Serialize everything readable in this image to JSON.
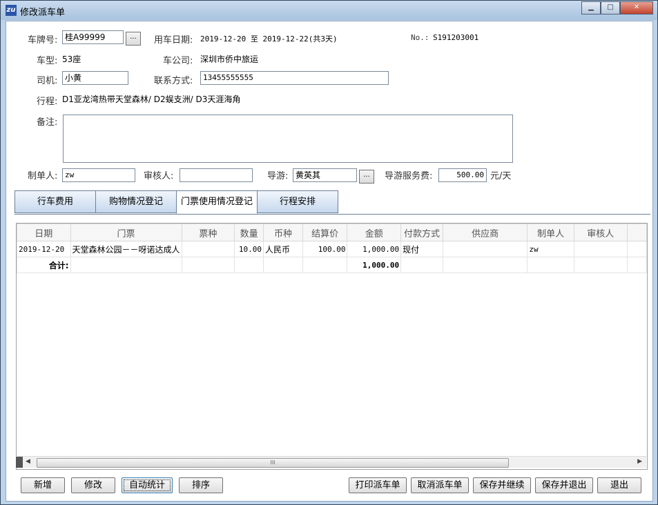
{
  "window": {
    "title": "修改派车单",
    "app_icon": "zu"
  },
  "form": {
    "plate_label": "车牌号:",
    "plate_value": "桂A99999",
    "ellipsis": "...",
    "date_label": "用车日期:",
    "date_value": "2019-12-20 至 2019-12-22(共3天)",
    "no_label": "No.:",
    "no_value": "S191203001",
    "type_label": "车型:",
    "type_value": "53座",
    "company_label": "车公司:",
    "company_value": "深圳市侨中旅运",
    "driver_label": "司机:",
    "driver_value": "小黄",
    "contact_label": "联系方式:",
    "contact_value": "13455555555",
    "trip_label": "行程:",
    "trip_value": "D1亚龙湾热带天堂森林/ D2蜈支洲/ D3天涯海角",
    "remark_label": "备注:",
    "remark_value": "",
    "maker_label": "制单人:",
    "maker_value": "zw",
    "auditor_label": "审核人:",
    "auditor_value": "",
    "guide_label": "导游:",
    "guide_value": "黄英其",
    "fee_label": "导游服务费:",
    "fee_value": "500.00",
    "fee_unit": "元/天"
  },
  "tabs": [
    "行车费用",
    "购物情况登记",
    "门票使用情况登记",
    "行程安排"
  ],
  "grid": {
    "headers": [
      "日期",
      "门票",
      "票种",
      "数量",
      "币种",
      "结算价",
      "金额",
      "付款方式",
      "供应商",
      "制单人",
      "审核人"
    ],
    "rows": [
      [
        "2019-12-20",
        "天堂森林公园－－呀诺达成人",
        "",
        "10.00",
        "人民币",
        "100.00",
        "1,000.00",
        "现付",
        "",
        "zw",
        ""
      ]
    ],
    "total_label": "合计:",
    "total_amount": "1,000.00",
    "scroll_grip": "III"
  },
  "buttons": {
    "add": "新增",
    "edit": "修改",
    "auto_stat": "自动统计",
    "sort": "排序",
    "print": "打印派车单",
    "cancel_order": "取消派车单",
    "save_continue": "保存并继续",
    "save_exit": "保存并退出",
    "exit": "退出"
  },
  "colors": {
    "frame": "#bcd3ea",
    "tab_gradient_end": "#c6d8ee"
  }
}
